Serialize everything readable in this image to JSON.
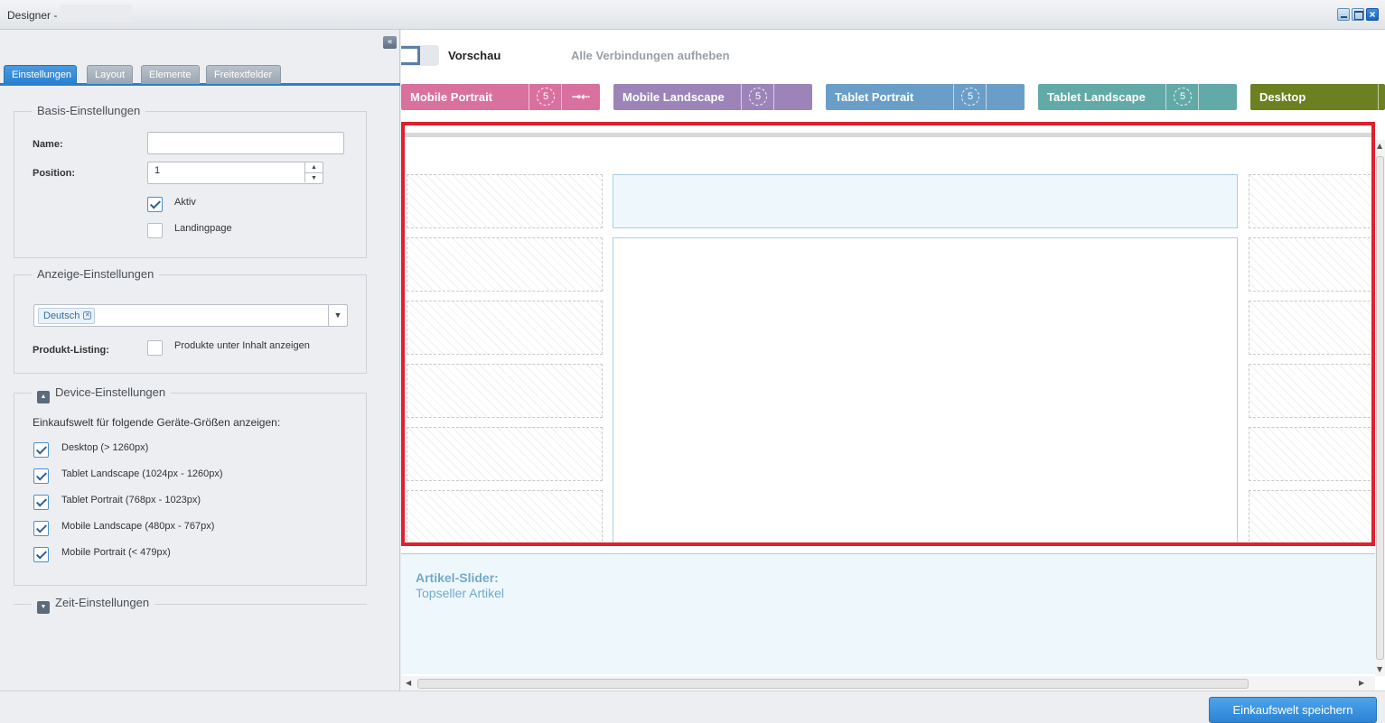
{
  "window": {
    "title": "Designer -"
  },
  "left_panel": {
    "collapse_glyph": "«",
    "tabs": [
      {
        "label": "Einstellungen",
        "active": true
      },
      {
        "label": "Layout",
        "active": false
      },
      {
        "label": "Elemente",
        "active": false
      },
      {
        "label": "Freitextfelder",
        "active": false
      }
    ],
    "basis": {
      "legend": "Basis-Einstellungen",
      "name_label": "Name:",
      "name_value": "",
      "position_label": "Position:",
      "position_value": "1",
      "aktiv_label": "Aktiv",
      "aktiv_checked": true,
      "landingpage_label": "Landingpage",
      "landingpage_checked": false
    },
    "anzeige": {
      "legend": "Anzeige-Einstellungen",
      "language_tag": "Deutsch",
      "produkt_listing_label": "Produkt-Listing:",
      "produkt_listing_option": "Produkte unter Inhalt anzeigen",
      "produkt_listing_checked": false
    },
    "device": {
      "legend": "Device-Einstellungen",
      "intro": "Einkaufswelt für folgende Geräte-Größen anzeigen:",
      "options": [
        {
          "label": "Desktop (> 1260px)",
          "checked": true
        },
        {
          "label": "Tablet Landscape (1024px - 1260px)",
          "checked": true
        },
        {
          "label": "Tablet Portrait (768px - 1023px)",
          "checked": true
        },
        {
          "label": "Mobile Landscape (480px - 767px)",
          "checked": true
        },
        {
          "label": "Mobile Portrait (< 479px)",
          "checked": true
        }
      ]
    },
    "zeit": {
      "legend": "Zeit-Einstellungen"
    }
  },
  "toolbar": {
    "preview_label": "Vorschau",
    "unlink_all_label": "Alle Verbindungen aufheben"
  },
  "devices": [
    {
      "name": "Mobile Portrait",
      "count": "5",
      "color": "#d9719f"
    },
    {
      "name": "Mobile Landscape",
      "count": "5",
      "color": "#9c84b9"
    },
    {
      "name": "Tablet Portrait",
      "count": "5",
      "color": "#6a9ec8"
    },
    {
      "name": "Tablet Landscape",
      "count": "5",
      "color": "#62aaa8"
    },
    {
      "name": "Desktop",
      "count": "",
      "color": "#6c8022"
    }
  ],
  "canvas": {
    "slider_element_title": "Artikel-Slider:",
    "slider_element_subtitle": "Topseller Artikel",
    "selection_color": "#e0202e"
  },
  "footer": {
    "save_label": "Einkaufswelt speichern"
  }
}
